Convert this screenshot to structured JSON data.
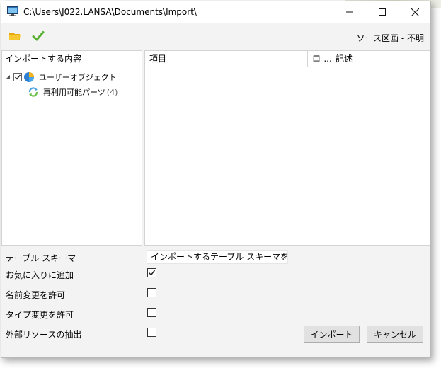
{
  "window": {
    "title": "C:\\Users\\J022.LANSA\\Documents\\Import\\",
    "controls": {
      "minimize": "minimize",
      "maximize": "maximize",
      "close": "close"
    }
  },
  "toolbar": {
    "open_icon": "folder-open-icon",
    "confirm_icon": "checkmark-icon",
    "source_label": "ソース区画 - 不明"
  },
  "tree": {
    "header": "インポートする内容",
    "items": [
      {
        "label": "ユーザーオブジェクト",
        "checked": true,
        "icon": "user-objects-icon"
      },
      {
        "label": "再利用可能パーツ",
        "count": "(4)",
        "icon": "reusable-part-icon"
      }
    ]
  },
  "grid": {
    "columns": [
      "項目",
      "ロ-...",
      "記述"
    ]
  },
  "options": {
    "table_schema_label": "テーブル スキーマ",
    "table_schema_value": "インポートするテーブル スキーマを使用する",
    "favorites_label": "お気に入りに追加",
    "favorites_checked": true,
    "rename_label": "名前変更を許可",
    "rename_checked": false,
    "retype_label": "タイプ変更を許可",
    "retype_checked": false,
    "external_label": "外部リソースの抽出",
    "external_checked": false
  },
  "buttons": {
    "import": "インポート",
    "cancel": "キャンセル"
  },
  "colors": {
    "window_bg": "#f3f3f3",
    "check_green": "#5ab52f",
    "folder_yellow": "#f2c21b"
  }
}
